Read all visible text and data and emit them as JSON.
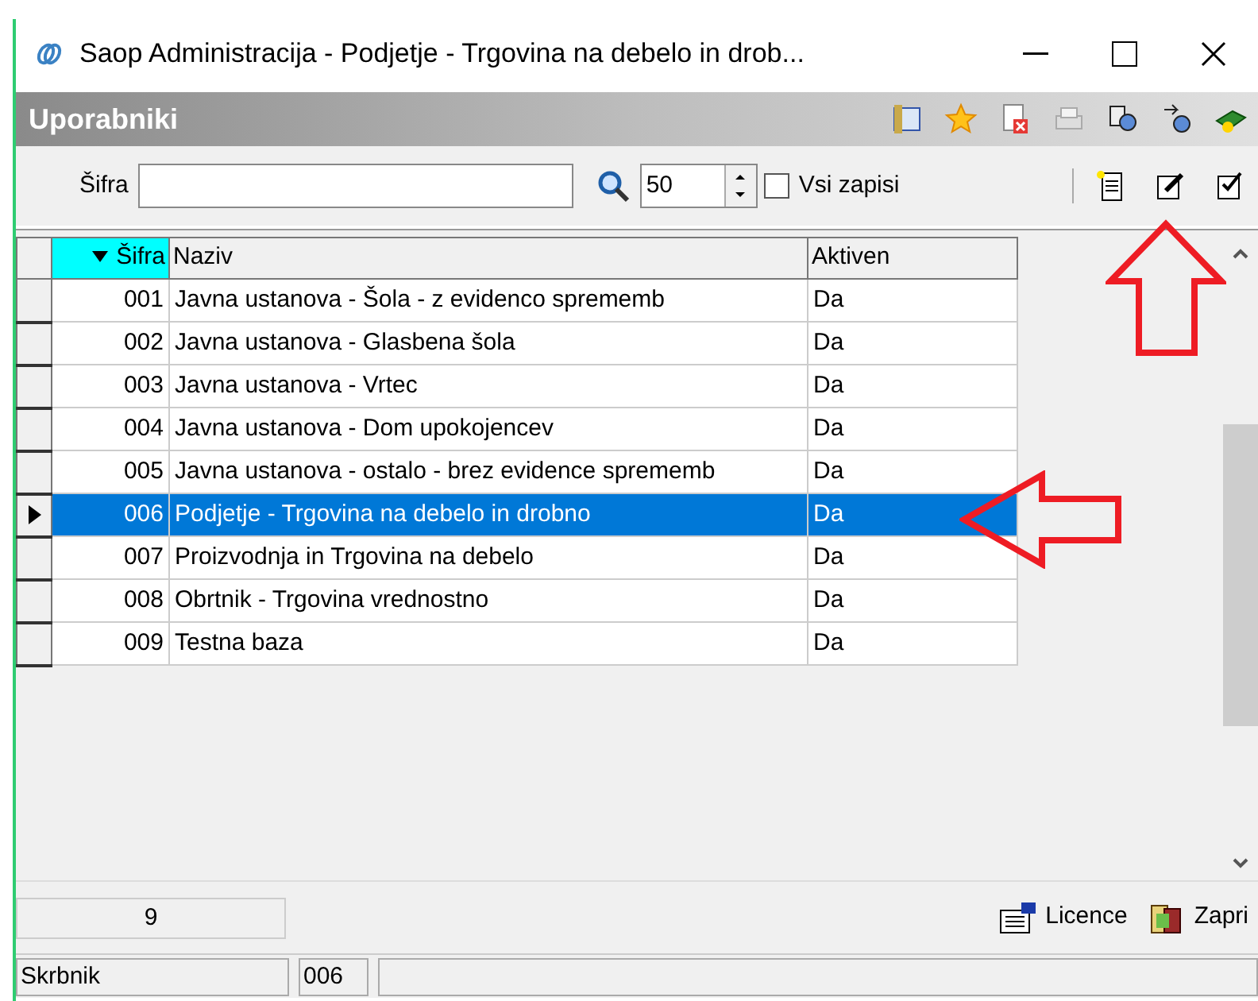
{
  "window": {
    "title": "Saop Administracija - Podjetje - Trgovina na debelo in drob..."
  },
  "header": {
    "title": "Uporabniki"
  },
  "filter": {
    "label": "Šifra",
    "count": "50",
    "all_records": {
      "label": "Vsi zapisi",
      "checked": false
    }
  },
  "table": {
    "columns": [
      {
        "label": "Šifra",
        "sorted": true
      },
      {
        "label": "Naziv",
        "sorted": false
      },
      {
        "label": "Aktiven",
        "sorted": false
      }
    ],
    "rows": [
      {
        "code": "001",
        "name": "Javna ustanova - Šola - z evidenco sprememb",
        "active": "Da",
        "selected": false
      },
      {
        "code": "002",
        "name": "Javna ustanova - Glasbena šola",
        "active": "Da",
        "selected": false
      },
      {
        "code": "003",
        "name": "Javna ustanova - Vrtec",
        "active": "Da",
        "selected": false
      },
      {
        "code": "004",
        "name": "Javna ustanova - Dom upokojencev",
        "active": "Da",
        "selected": false
      },
      {
        "code": "005",
        "name": "Javna ustanova - ostalo - brez evidence sprememb",
        "active": "Da",
        "selected": false
      },
      {
        "code": "006",
        "name": "Podjetje - Trgovina na debelo in drobno",
        "active": "Da",
        "selected": true
      },
      {
        "code": "007",
        "name": "Proizvodnja in Trgovina na debelo",
        "active": "Da",
        "selected": false
      },
      {
        "code": "008",
        "name": "Obrtnik - Trgovina vrednostno",
        "active": "Da",
        "selected": false
      },
      {
        "code": "009",
        "name": "Testna baza",
        "active": "Da",
        "selected": false
      }
    ]
  },
  "record_count": "9",
  "buttons": [
    {
      "label": "Licence"
    },
    {
      "label": "Zapri"
    }
  ],
  "status_bar": {
    "user": "Skrbnik",
    "code": "006"
  }
}
